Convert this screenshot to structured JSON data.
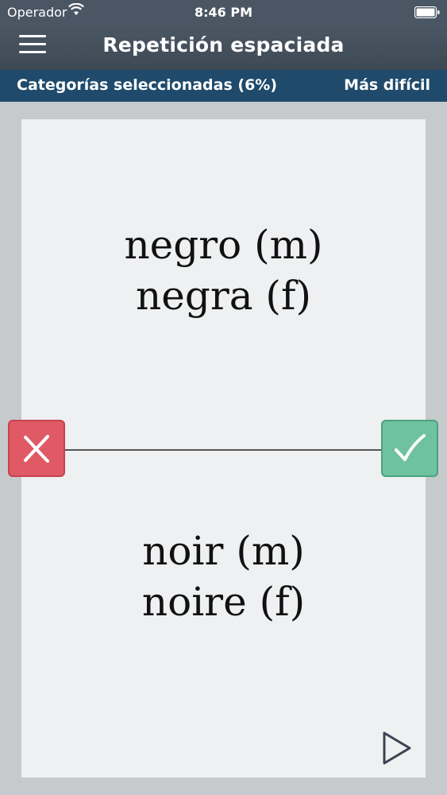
{
  "status_bar": {
    "carrier": "Operador",
    "time": "8:46 PM"
  },
  "nav": {
    "title": "Repetición espaciada"
  },
  "subbar": {
    "categories_label": "Categorías seleccionadas (6%)",
    "difficulty_label": "Más difícil"
  },
  "card": {
    "front_lines": [
      "negro (m)",
      "negra (f)"
    ],
    "back_lines": [
      "noir (m)",
      "noire (f)"
    ]
  },
  "colors": {
    "status_bar_bg": "#4a5663",
    "subbar_bg": "#1f4a6b",
    "wrong_button": "#e05a66",
    "correct_button": "#6ec29f"
  },
  "icons": {
    "menu": "hamburger-icon",
    "wrong": "close-icon",
    "correct": "checkmark-icon",
    "play": "play-icon",
    "wifi": "wifi-icon",
    "battery": "battery-icon"
  }
}
